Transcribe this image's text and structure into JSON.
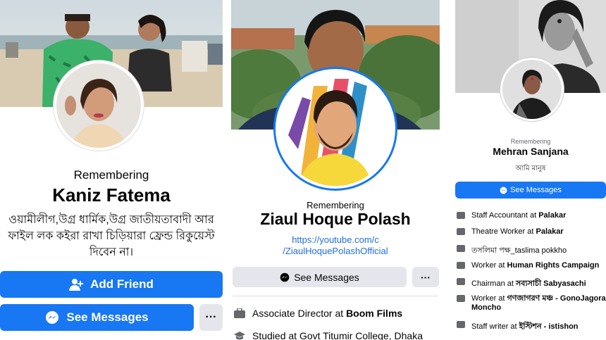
{
  "panel1": {
    "remembering": "Remembering",
    "name": "Kaniz Fatema",
    "bio_line1": "ওয়ামীলীগ,উগ্র ধার্মিক,উগ্র জাতীয়তাবাদী আর",
    "bio_line2": "ফাইল লক কইরা রাখা চিড়িয়ারা ফ্রেন্ড রিকুয়েস্ট",
    "bio_line3": "দিবেন না।",
    "add_friend_label": "Add Friend",
    "see_messages_label": "See Messages",
    "more_label": "···"
  },
  "panel2": {
    "remembering": "Remembering",
    "name": "Ziaul Hoque Polash",
    "link_line1": "https://youtube.com/c",
    "link_line2": "/ZiaulHoquePolashOfficial",
    "see_messages_label": "See Messages",
    "more_label": "···",
    "info": [
      {
        "prefix": "Associate Director at ",
        "bold": "Boom Films",
        "icon": "briefcase-icon"
      },
      {
        "prefix": "Studied at Govt Titumir College, Dhaka",
        "bold": "",
        "icon": "graduation-cap-icon"
      }
    ]
  },
  "panel3": {
    "remembering": "Remembering",
    "name": "Mehran Sanjana",
    "bio": "আমি মানুষ",
    "see_messages_label": "See Messages",
    "info": [
      {
        "prefix": "Staff Accountant at ",
        "bold": "Palakar",
        "icon": "briefcase-icon"
      },
      {
        "prefix": "Theatre Worker at ",
        "bold": "Palakar",
        "icon": "briefcase-icon"
      },
      {
        "prefix": "তসলিমা পক্ষ_taslima pokkho",
        "bold": "",
        "icon": "briefcase-icon"
      },
      {
        "prefix": "Worker at ",
        "bold": "Human Rights Campaign",
        "icon": "briefcase-icon"
      },
      {
        "prefix": "Chairman at ",
        "bold": "সব্যসাচী Sabyasachi",
        "icon": "briefcase-icon"
      },
      {
        "prefix": "Worker at ",
        "bold": "গণজাগরণ মঞ্চ - GonoJagoran",
        "bold2": "Moncho",
        "icon": "briefcase-icon"
      },
      {
        "prefix": "Staff writer at ",
        "bold": "ইস্টিশন - istishon",
        "icon": "briefcase-icon"
      }
    ]
  },
  "colors": {
    "accent": "#1877f2",
    "button_grey": "#e4e6eb",
    "link": "#216fdb",
    "secondary_text": "#65676b"
  }
}
